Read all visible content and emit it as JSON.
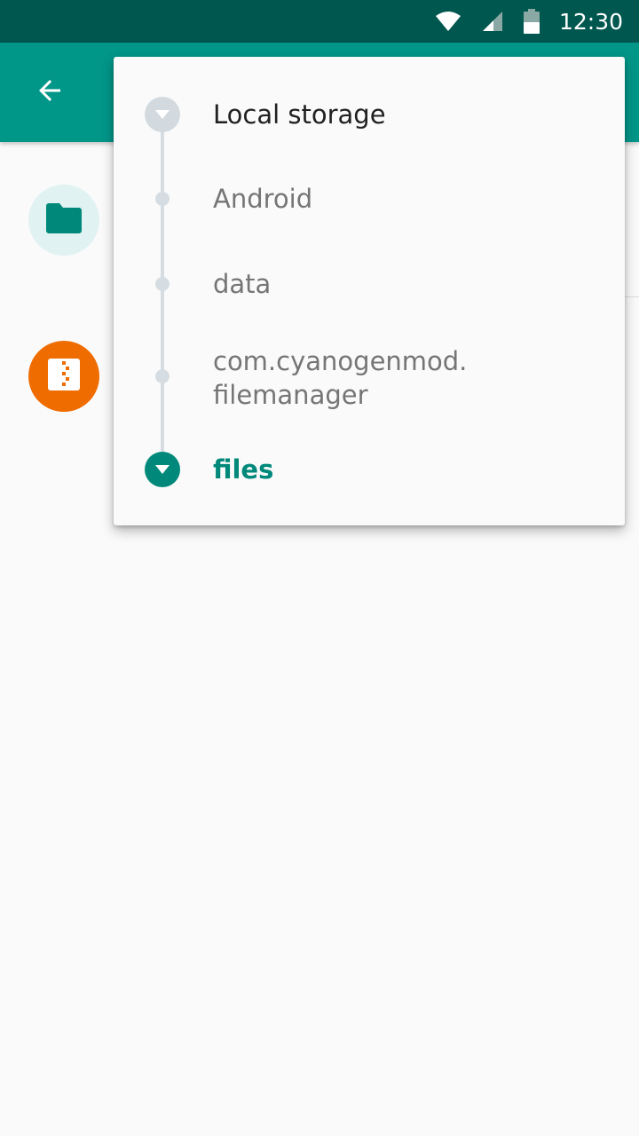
{
  "status_bar": {
    "time": "12:30",
    "icons": [
      "wifi-icon",
      "cell-signal-icon",
      "battery-icon"
    ],
    "background": "#00574f"
  },
  "toolbar": {
    "back_icon": "arrow-back-icon",
    "background": "#009688"
  },
  "file_list": {
    "items": [
      {
        "icon": "folder-icon",
        "avatar_color": "#e0f2f1"
      },
      {
        "icon": "archive-zip-icon",
        "avatar_color": "#ef6c00"
      }
    ]
  },
  "breadcrumb": {
    "items": [
      {
        "label": "Local storage",
        "type": "root"
      },
      {
        "label": "Android",
        "type": "folder"
      },
      {
        "label": "data",
        "type": "folder"
      },
      {
        "label": "com.cyanogenmod.\nfilemanager",
        "type": "folder"
      },
      {
        "label": "files",
        "type": "current"
      }
    ],
    "accent_color": "#00897b"
  }
}
